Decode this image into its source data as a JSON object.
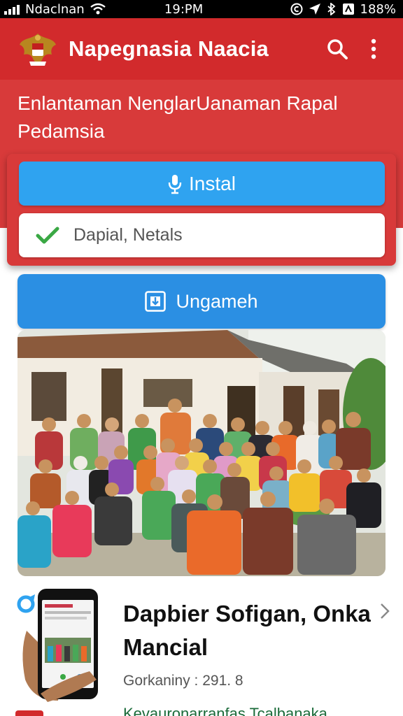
{
  "status_bar": {
    "carrier": "Ndaclnan",
    "time": "19:PM",
    "battery": "188%"
  },
  "app_bar": {
    "title": "Napegnasia Naacia"
  },
  "hero": {
    "text": "Enlantaman NenglarUanaman Rapal Pedamsia"
  },
  "buttons": {
    "install_label": "Instal",
    "status_value": "Dapial, Netals",
    "update_label": "Ungameh"
  },
  "list_item": {
    "title": "Dapbier Sofigan, Onka Mancial",
    "meta": "Gorkaniny : 291. 8",
    "link": "Kevauronarranfas Tcalbanaka"
  },
  "colors": {
    "brand_red": "#d22a2c",
    "accent_blue": "#2fa3f0",
    "check_green": "#3aa844"
  }
}
